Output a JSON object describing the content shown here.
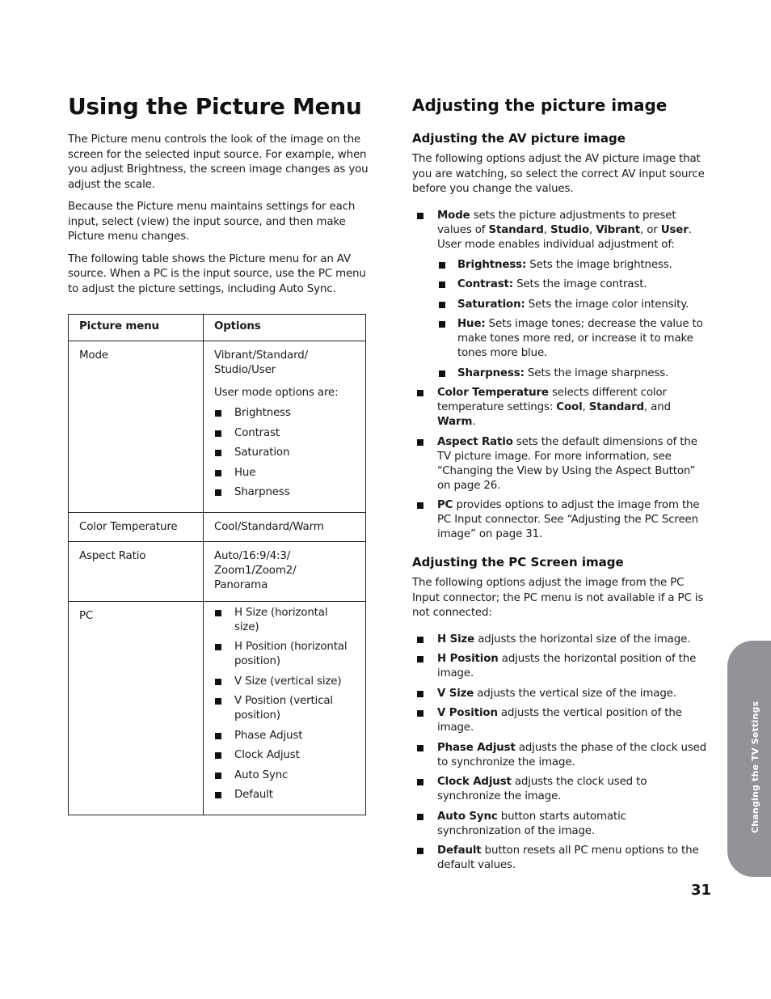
{
  "left": {
    "title": "Using the Picture Menu",
    "paragraphs": [
      "The Picture menu controls the look of the image on the screen for the selected input source. For example, when you adjust Brightness, the screen image changes as you adjust the scale.",
      "Because the Picture menu maintains settings for each input, select (view) the input source, and then make Picture menu changes.",
      "The following table shows the Picture menu for an AV source. When a PC is the input source, use the PC menu to adjust the picture settings, including Auto Sync."
    ],
    "table": {
      "headers": [
        "Picture menu",
        "Options"
      ],
      "rows": [
        {
          "menu": "Mode",
          "option_text": "Vibrant/Standard/ Studio/User",
          "option_note": "User mode options are:",
          "option_items": [
            "Brightness",
            "Contrast",
            "Saturation",
            "Hue",
            "Sharpness"
          ]
        },
        {
          "menu": "Color Temperature",
          "option_text": "Cool/Standard/Warm"
        },
        {
          "menu": "Aspect Ratio",
          "option_text": "Auto/16:9/4:3/ Zoom1/Zoom2/ Panorama"
        },
        {
          "menu": "PC",
          "option_items": [
            "H Size (horizontal size)",
            "H Position (horizontal position)",
            "V Size (vertical size)",
            "V Position (vertical position)",
            "Phase Adjust",
            "Clock Adjust",
            "Auto Sync",
            "Default"
          ]
        }
      ]
    }
  },
  "right": {
    "title": "Adjusting the picture image",
    "av": {
      "heading": "Adjusting the AV picture image",
      "intro": "The following options adjust the AV picture image that you are watching, so select the correct AV input source before you change the values.",
      "mode": {
        "term": "Mode",
        "t1": " sets the picture adjustments to preset values of ",
        "v1": "Standard",
        "s1": ", ",
        "v2": "Studio",
        "s2": ", ",
        "v3": "Vibrant",
        "s3": ", or ",
        "v4": "User",
        "t2": ". User mode enables individual adjustment of:",
        "sub": [
          {
            "term": "Brightness:",
            "desc": " Sets the image brightness."
          },
          {
            "term": "Contrast:",
            "desc": " Sets the image contrast."
          },
          {
            "term": "Saturation:",
            "desc": " Sets the image color intensity."
          },
          {
            "term": "Hue:",
            "desc": " Sets image tones; decrease the value to make tones more red, or increase it to make tones more blue."
          },
          {
            "term": "Sharpness:",
            "desc": " Sets the image sharpness."
          }
        ]
      },
      "color_temp": {
        "term": "Color Temperature",
        "t1": " selects different color temperature settings: ",
        "v1": "Cool",
        "s1": ", ",
        "v2": "Standard",
        "s2": ", and ",
        "v3": "Warm",
        "t2": "."
      },
      "aspect": {
        "term": "Aspect Ratio",
        "desc": " sets the default dimensions of the TV picture image. For more information, see “Changing the View by Using the Aspect Button” on page 26."
      },
      "pc": {
        "term": "PC",
        "desc": " provides options to adjust the image from the PC Input connector. See “Adjusting the PC Screen image” on page 31."
      }
    },
    "pc_screen": {
      "heading": "Adjusting the PC Screen image",
      "intro": "The following options adjust the image from the PC Input connector; the PC menu is not available if a PC is not connected:",
      "items": [
        {
          "term": "H Size",
          "desc": " adjusts the horizontal size of the image."
        },
        {
          "term": "H Position",
          "desc": " adjusts the horizontal position of the image."
        },
        {
          "term": "V Size",
          "desc": " adjusts the vertical size of the image."
        },
        {
          "term": "V Position",
          "desc": " adjusts the vertical position of the image."
        },
        {
          "term": "Phase Adjust",
          "desc": " adjusts the phase of the clock used to synchronize the image."
        },
        {
          "term": "Clock Adjust",
          "desc": " adjusts the clock used to synchronize the image."
        },
        {
          "term": "Auto Sync",
          "desc": " button starts automatic synchronization of the image."
        },
        {
          "term": "Default",
          "desc": " button resets all PC menu options to the default values."
        }
      ]
    }
  },
  "footer": {
    "page_number": "31",
    "side_tab_label": "Changing the TV Settings",
    "side_tab_color": "#929397"
  }
}
